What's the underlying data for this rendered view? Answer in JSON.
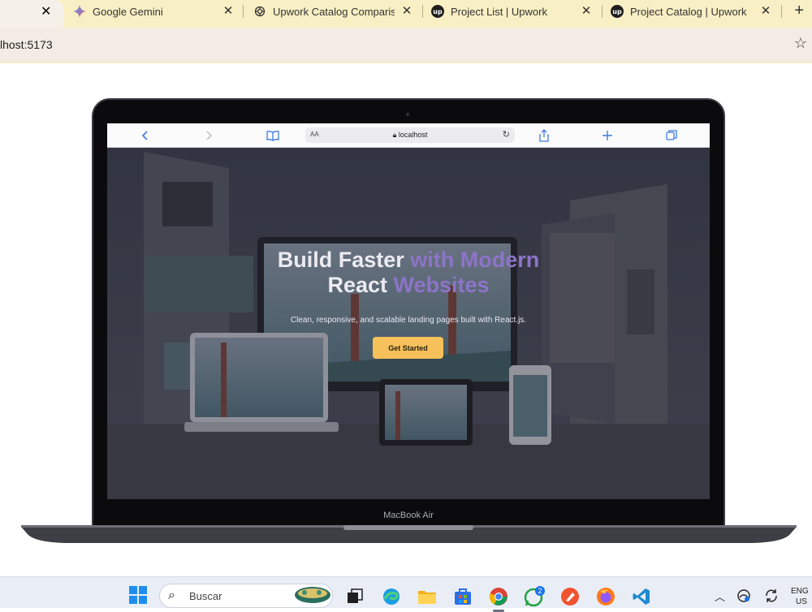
{
  "browser": {
    "tabs": [
      {
        "title": "Google Gemini",
        "icon": "gemini-icon"
      },
      {
        "title": "Upwork Catalog Comparison",
        "icon": "openai-icon"
      },
      {
        "title": "Project List | Upwork",
        "icon": "upwork-icon"
      },
      {
        "title": "Project Catalog | Upwork",
        "icon": "upwork-icon"
      }
    ],
    "close_glyph": "✕",
    "new_tab": "+",
    "address": "lhost:5173",
    "upwork_badge": "up"
  },
  "laptop": {
    "model_label": "MacBook Air",
    "safari": {
      "text_size": "AA",
      "host": "localhost"
    },
    "hero": {
      "title_line1_plain": "Build Faster ",
      "title_line1_accent": "with Modern",
      "title_line2_plain": "React ",
      "title_line2_accent": "Websites",
      "subtitle": "Clean, responsive, and scalable landing pages built with React.js.",
      "cta": "Get Started"
    }
  },
  "taskbar": {
    "search_placeholder": "Buscar",
    "whatsapp_badge": "2",
    "language_line1": "ENG",
    "language_line2": "US"
  },
  "colors": {
    "tabbar": "#f9efc4",
    "hero_accent": "#8d74c8",
    "cta": "#f6c05a",
    "windows_blue": "#1d8ef0"
  }
}
